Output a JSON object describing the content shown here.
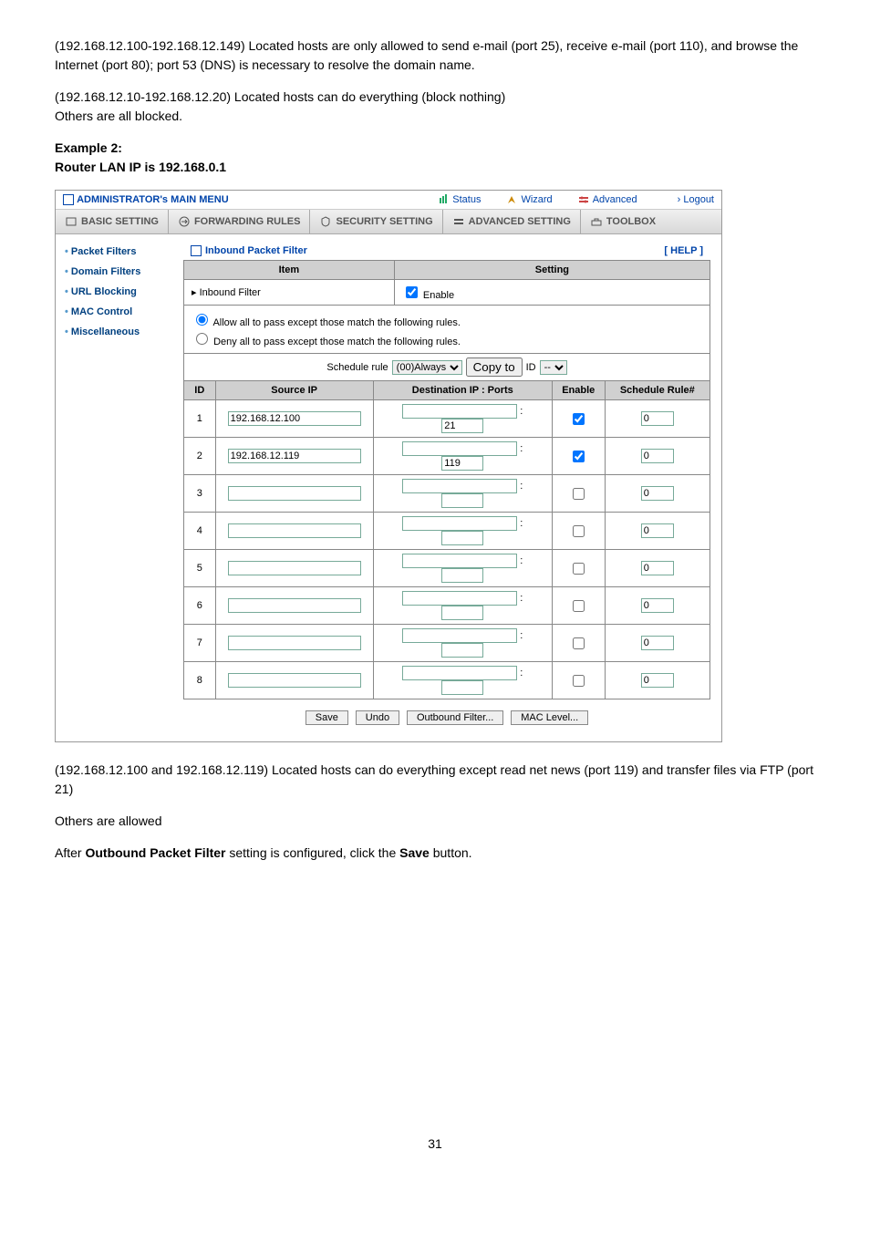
{
  "doc": {
    "p1": "(192.168.12.100-192.168.12.149) Located hosts are only allowed to send e-mail (port 25), receive e-mail (port 110), and browse the Internet (port 80); port 53 (DNS) is necessary to resolve the domain name.",
    "p2_line1": "(192.168.12.10-192.168.12.20) Located hosts can do everything (block nothing)",
    "p2_line2": "Others are all blocked.",
    "example_label": "Example 2:",
    "router_line": "Router LAN IP is 192.168.0.1",
    "p3": "(192.168.12.100 and 192.168.12.119) Located hosts can do everything except read net news (port 119) and transfer files via FTP (port 21)",
    "p4": "Others are allowed",
    "p5_a": "After ",
    "p5_b": "Outbound Packet Filter",
    "p5_c": " setting is configured, click the ",
    "p5_d": "Save",
    "p5_e": " button.",
    "page_number": "31"
  },
  "ui": {
    "topbar": {
      "title": "ADMINISTRATOR's MAIN MENU",
      "status": "Status",
      "wizard": "Wizard",
      "advanced": "Advanced",
      "logout": "› Logout"
    },
    "navbar": {
      "basic": "BASIC SETTING",
      "forwarding": "FORWARDING RULES",
      "security": "SECURITY SETTING",
      "advanced": "ADVANCED SETTING",
      "toolbox": "TOOLBOX"
    },
    "sidebar": {
      "items": [
        {
          "label": "Packet Filters"
        },
        {
          "label": "Domain Filters"
        },
        {
          "label": "URL Blocking"
        },
        {
          "label": "MAC Control"
        },
        {
          "label": "Miscellaneous"
        }
      ]
    },
    "panel": {
      "title": "Inbound Packet Filter",
      "help": "[ HELP ]",
      "item_header": "Item",
      "setting_header": "Setting",
      "inbound_filter_label": "▸ Inbound Filter",
      "enable_label": "Enable",
      "radio_allow": "Allow all to pass except those match the following rules.",
      "radio_deny": "Deny all to pass except those match the following rules.",
      "schedule_text": "Schedule rule",
      "schedule_option": "(00)Always",
      "copy_to_btn": "Copy to",
      "id_label": "ID",
      "id_option": "--",
      "col_id": "ID",
      "col_source": "Source IP",
      "col_dest": "Destination IP : Ports",
      "col_enable": "Enable",
      "col_rule": "Schedule Rule#",
      "rows": [
        {
          "id": "1",
          "src": "192.168.12.100",
          "dest": "",
          "port": "21",
          "enable": true,
          "rule": "0"
        },
        {
          "id": "2",
          "src": "192.168.12.119",
          "dest": "",
          "port": "119",
          "enable": true,
          "rule": "0"
        },
        {
          "id": "3",
          "src": "",
          "dest": "",
          "port": "",
          "enable": false,
          "rule": "0"
        },
        {
          "id": "4",
          "src": "",
          "dest": "",
          "port": "",
          "enable": false,
          "rule": "0"
        },
        {
          "id": "5",
          "src": "",
          "dest": "",
          "port": "",
          "enable": false,
          "rule": "0"
        },
        {
          "id": "6",
          "src": "",
          "dest": "",
          "port": "",
          "enable": false,
          "rule": "0"
        },
        {
          "id": "7",
          "src": "",
          "dest": "",
          "port": "",
          "enable": false,
          "rule": "0"
        },
        {
          "id": "8",
          "src": "",
          "dest": "",
          "port": "",
          "enable": false,
          "rule": "0"
        }
      ],
      "buttons": {
        "save": "Save",
        "undo": "Undo",
        "outbound": "Outbound Filter...",
        "mac": "MAC Level..."
      }
    }
  }
}
